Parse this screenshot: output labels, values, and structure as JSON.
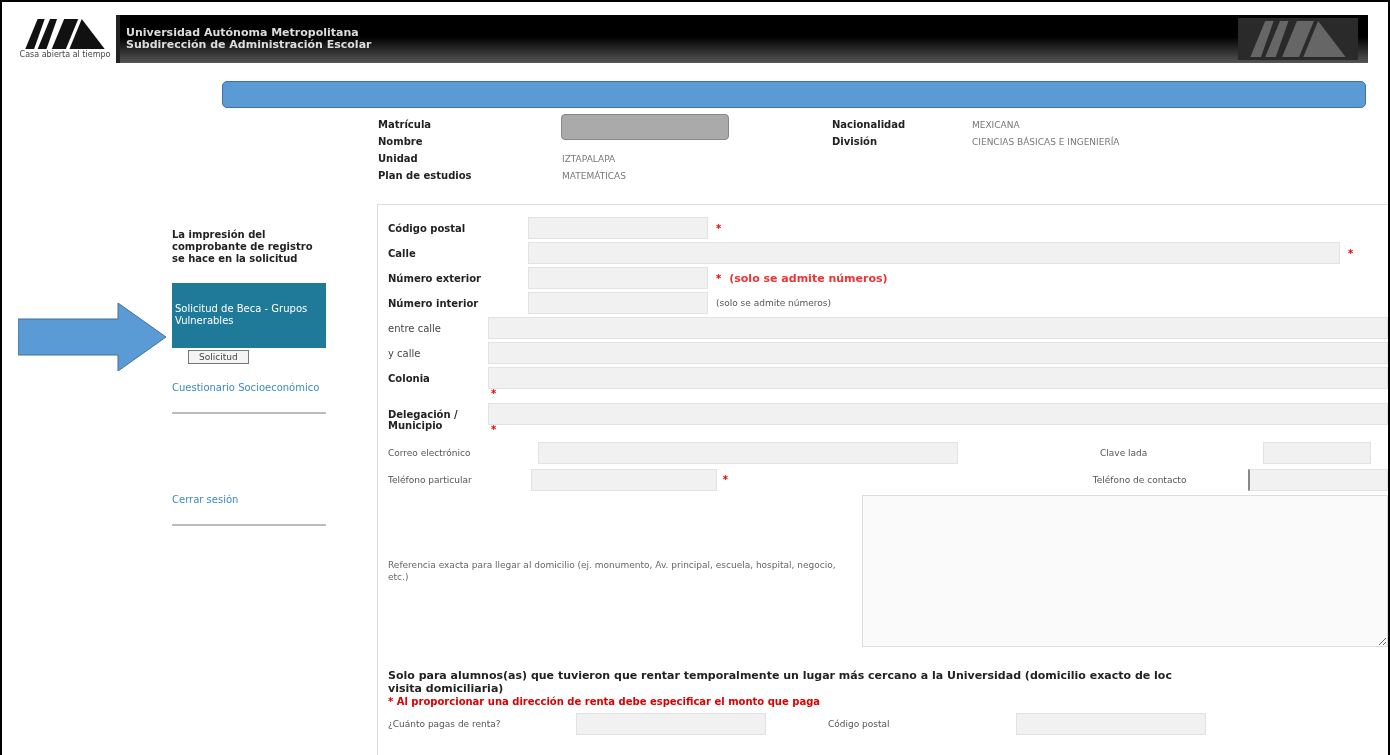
{
  "header": {
    "logo_caption": "Casa abierta al tiempo",
    "title": "Universidad Autónoma Metropolitana",
    "subtitle": "Subdirección de Administración Escolar"
  },
  "student": {
    "left": [
      {
        "label": "Matrícula"
      },
      {
        "label": "Nombre"
      },
      {
        "label": "Unidad",
        "value": "IZTAPALAPA"
      },
      {
        "label": "Plan de estudios",
        "value": "MATEMÁTICAS"
      }
    ],
    "right": [
      {
        "label": "Nacionalidad",
        "value": "MEXICANA"
      },
      {
        "label": "División",
        "value": "CIENCIAS BÁSICAS E INGENIERÍA"
      }
    ]
  },
  "sidebar": {
    "notice": "La impresión del comprobante de registro se hace en la solicitud",
    "items": [
      {
        "label": "Solicitud de Beca - Grupos Vulnerables",
        "selected": true,
        "button": "Solicitud"
      },
      {
        "label": "Cuestionario Socioeconómico",
        "selected": false
      },
      {
        "label": "Cerrar sesión",
        "selected": false
      }
    ]
  },
  "address_fields": [
    {
      "label": "Código postal",
      "bold": true,
      "kind": "short",
      "mark": "*",
      "mark_below": false
    },
    {
      "label": "Calle",
      "bold": true,
      "kind": "wide",
      "mark": "*",
      "mark_below": false
    },
    {
      "label": "Número exterior",
      "bold": true,
      "kind": "short",
      "mark": "*",
      "mark_below": false,
      "note": "(solo se admite números)",
      "note_warning": true
    },
    {
      "label": "Número interior",
      "bold": true,
      "kind": "short",
      "note": "(solo se admite números)",
      "note_warning": false
    },
    {
      "label": "entre calle",
      "bold": false,
      "kind": "full"
    },
    {
      "label": "y calle",
      "bold": false,
      "kind": "full"
    },
    {
      "label": "Colonia",
      "bold": true,
      "kind": "full",
      "mark": "*",
      "mark_below": true
    },
    {
      "label": "Delegación / Municipio",
      "bold": true,
      "kind": "full",
      "mark": "*",
      "mark_below": true
    }
  ],
  "contact_rows": [
    {
      "left": {
        "label": "Correo electrónico",
        "kind": "email"
      },
      "right": {
        "label": "Clave lada",
        "kind": "lada"
      }
    },
    {
      "left": {
        "label": "Teléfono particular",
        "kind": "phone",
        "mark": "*"
      },
      "right": {
        "label": "Teléfono de contacto",
        "kind": "contact"
      }
    }
  ],
  "reference": {
    "label": "Referencia exacta para llegar al domicilio (ej. monumento, Av. principal, escuela, hospital, negocio, etc.)"
  },
  "rent": {
    "heading_lines": [
      "Solo para alumnos(as) que tuvieron que rentar temporalmente un lugar más cercano a la Universidad (domicilio exacto de loc",
      "visita domiciliaria)"
    ],
    "warning": "* Al proporcionar una dirección de renta debe especificar el monto que paga",
    "fields": [
      {
        "label": "¿Cuánto pagas de renta?"
      },
      {
        "label": "Código postal"
      }
    ]
  }
}
